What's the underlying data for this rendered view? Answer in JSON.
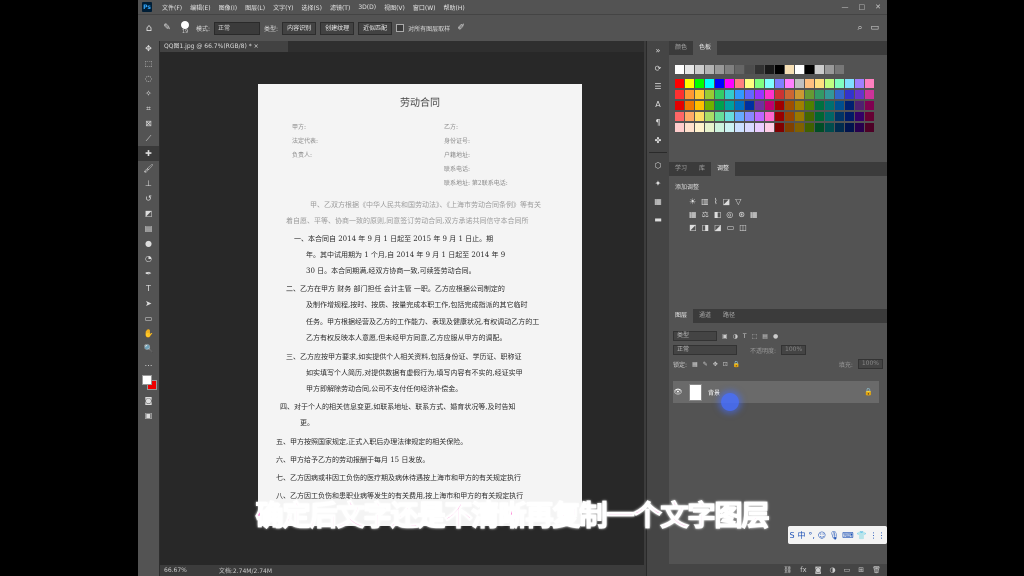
{
  "menubar": {
    "logo": "Ps",
    "items": [
      "文件(F)",
      "编辑(E)",
      "图像(I)",
      "图层(L)",
      "文字(Y)",
      "选择(S)",
      "滤镜(T)",
      "3D(D)",
      "视图(V)",
      "窗口(W)",
      "帮助(H)"
    ],
    "window_controls": [
      "—",
      "□",
      "✕"
    ]
  },
  "options": {
    "mode_label": "模式:",
    "mode_value": "正常",
    "type_label": "类型:",
    "btn_content_aware": "内容识别",
    "btn_create_texture": "创建纹理",
    "btn_proximity": "近似匹配",
    "sample_all_layers": "对所有图层取样",
    "brush_size": "19"
  },
  "document": {
    "tab_title": "QQ图1.jpg @ 66.7%(RGB/8) *",
    "tab_close": "×",
    "paper": {
      "title": "劳动合同",
      "header_lines": [
        "甲方:",
        "法定代表:",
        "负责人:",
        "乙方:",
        "身份证号:",
        "户籍地址:",
        "联系电话:",
        "联系地址: 第2联系电话:"
      ],
      "body_lines": [
        "甲、乙双方根据《中华人民共和国劳动法》、《上海市劳动合同条例》等有关",
        "着自愿、平等、协商一致的原则,同意签订劳动合同,双方承诺共同信守本合同所",
        "一、本合同自 2014 年 9 月 1 日起至 2015 年 9 月 1 日止。期",
        "年。其中试用期为 1 个月,自 2014 年 9 月 1 日起至 2014 年 9",
        "30 日。本合同期满,经双方协商一致,可续签劳动合同。",
        "二、乙方在甲方 财务 部门担任 会计主管 一职。乙方应根据公司制定的",
        "及制作增规程,按时、按质、按量完成本职工作,包括完成指派的其它临时",
        "任务。甲方根据经营及乙方的工作能力、表现及健康状况,有权调动乙方的工",
        "乙方有权反映本人意愿,但未经甲方同意,乙方应服从甲方的调配。",
        "三、乙方应按甲方要求,如实提供个人相关资料,包括身份证、学历证、职称证",
        "如实填写个人简历,对提供数据有虚假行为,填写内容有不实的,经证实甲",
        "甲方即解除劳动合同,公司不支付任何经济补偿金。",
        "四、对于个人的相关信息变更,如联系地址、联系方式、婚育状况等,及时告知",
        "更。",
        "五、甲方按照国家规定,正式入职后办理法律规定的相关保险。",
        "六、甲方给予乙方的劳动报酬于每月 15 日发放。",
        "七、乙方因病或非因工负伤的医疗期及病休待遇按上海市和甲方的有关规定执行",
        "八、乙方因工负伤和患职业病等发生的有关费用,按上海市和甲方的有关规定执行"
      ]
    }
  },
  "status": {
    "zoom": "66.67%",
    "doc_size": "文档:2.74M/2.74M"
  },
  "panels": {
    "swatch_tabs": [
      "颜色",
      "色板"
    ],
    "adjust_tabs": [
      "学习",
      "库",
      "调整"
    ],
    "adjust_label": "添加调整",
    "layer_tabs": [
      "图层",
      "通道",
      "路径"
    ],
    "layer_filter": "类型",
    "blend_mode": "正常",
    "opacity_label": "不透明度:",
    "opacity_value": "100%",
    "lock_label": "锁定:",
    "fill_label": "填充:",
    "fill_value": "100%",
    "layer_name": "背景"
  },
  "swatch_colors": [
    [
      "#ffffff",
      "#e6e6e6",
      "#cccccc",
      "#b3b3b3",
      "#999999",
      "#808080",
      "#666666",
      "#4d4d4d",
      "#333333",
      "#1a1a1a",
      "#000000",
      "#f5deb3",
      "#ffffff",
      "#000000",
      "#cccccc",
      "#999999",
      "#777777"
    ],
    [
      "#ff0000",
      "#ffff00",
      "#00ff00",
      "#00ffff",
      "#0000ff",
      "#ff00ff",
      "#ff8080",
      "#ffff80",
      "#80ff80",
      "#80ffff",
      "#8080ff",
      "#ff80ff",
      "#c0c0c0",
      "#ffc080",
      "#ffe080",
      "#c0ff80",
      "#80ffc0",
      "#80e0ff",
      "#a080ff",
      "#ff80c0"
    ],
    [
      "#ff3030",
      "#ff9933",
      "#ffcc33",
      "#99cc33",
      "#33cc66",
      "#33cccc",
      "#3399ff",
      "#6666ff",
      "#9933ff",
      "#ff33cc",
      "#cc3333",
      "#cc6633",
      "#cc9933",
      "#669933",
      "#339966",
      "#339999",
      "#3366cc",
      "#3333cc",
      "#6633cc",
      "#cc3399"
    ],
    [
      "#e60000",
      "#f07800",
      "#ffc000",
      "#70b000",
      "#00a050",
      "#00a0a0",
      "#0070c0",
      "#0030a0",
      "#7030a0",
      "#c00070",
      "#a00000",
      "#a05000",
      "#a08000",
      "#508000",
      "#007040",
      "#007070",
      "#004f8f",
      "#002070",
      "#502070",
      "#800050"
    ],
    [
      "#ff6666",
      "#ffaa66",
      "#ffdd66",
      "#aadd66",
      "#66dd99",
      "#66dddd",
      "#66aaff",
      "#8888ff",
      "#bb66ff",
      "#ff66cc",
      "#990000",
      "#994400",
      "#997700",
      "#446600",
      "#006633",
      "#006666",
      "#003366",
      "#001a66",
      "#330066",
      "#660033"
    ],
    [
      "#ffcccc",
      "#ffe0cc",
      "#fff2cc",
      "#e6f2cc",
      "#ccf2dd",
      "#ccf2f2",
      "#cce0ff",
      "#d9d9ff",
      "#eaccff",
      "#ffcce6",
      "#800000",
      "#804000",
      "#806000",
      "#406000",
      "#004d26",
      "#004d4d",
      "#002b4d",
      "#00134d",
      "#26004d",
      "#4d0026"
    ]
  ],
  "overlay": {
    "subtitle": "确定后文字还是不清晰再复制一个文字图层",
    "ime_items": [
      "S",
      "中",
      "°,",
      "☺",
      "🎙",
      "⌨",
      "👕",
      "⋮⋮"
    ]
  }
}
